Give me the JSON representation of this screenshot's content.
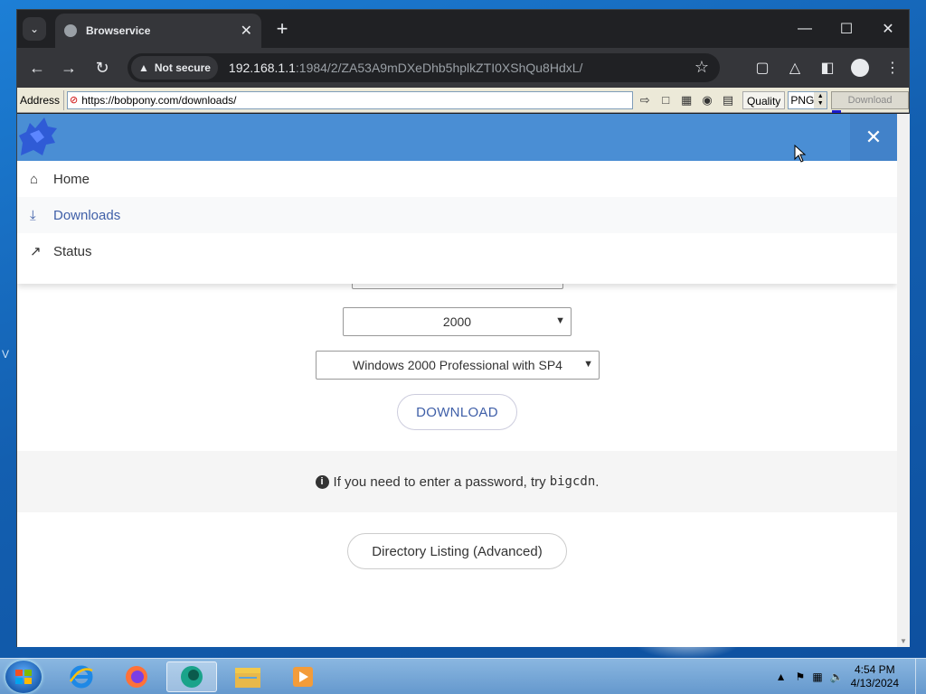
{
  "browser": {
    "tab_title": "Browservice",
    "security_label": "Not secure",
    "url_host": "192.168.1.1",
    "url_rest": ":1984/2/ZA53A9mDXeDhb5hplkZTI0XShQu8HdxL/"
  },
  "classic_toolbar": {
    "address_label": "Address",
    "address_value": "https://bobpony.com/downloads/",
    "quality_label": "Quality",
    "quality_value": "PNG",
    "download_label": "Download"
  },
  "nav": {
    "items": [
      {
        "label": "Home",
        "icon": "home-icon"
      },
      {
        "label": "Downloads",
        "icon": "download-icon"
      },
      {
        "label": "Status",
        "icon": "trending-icon"
      }
    ]
  },
  "content": {
    "version_select": "2000",
    "edition_select": "Windows 2000 Professional with SP4",
    "download_button": "DOWNLOAD",
    "info_text": "If you need to enter a password, try",
    "info_code": "bigcdn",
    "info_end": ".",
    "directory_button": "Directory Listing (Advanced)"
  },
  "taskbar": {
    "time": "4:54 PM",
    "date": "4/13/2024"
  },
  "colors": {
    "header": "#4a8ed4",
    "link_accent": "#3f5fa8"
  }
}
